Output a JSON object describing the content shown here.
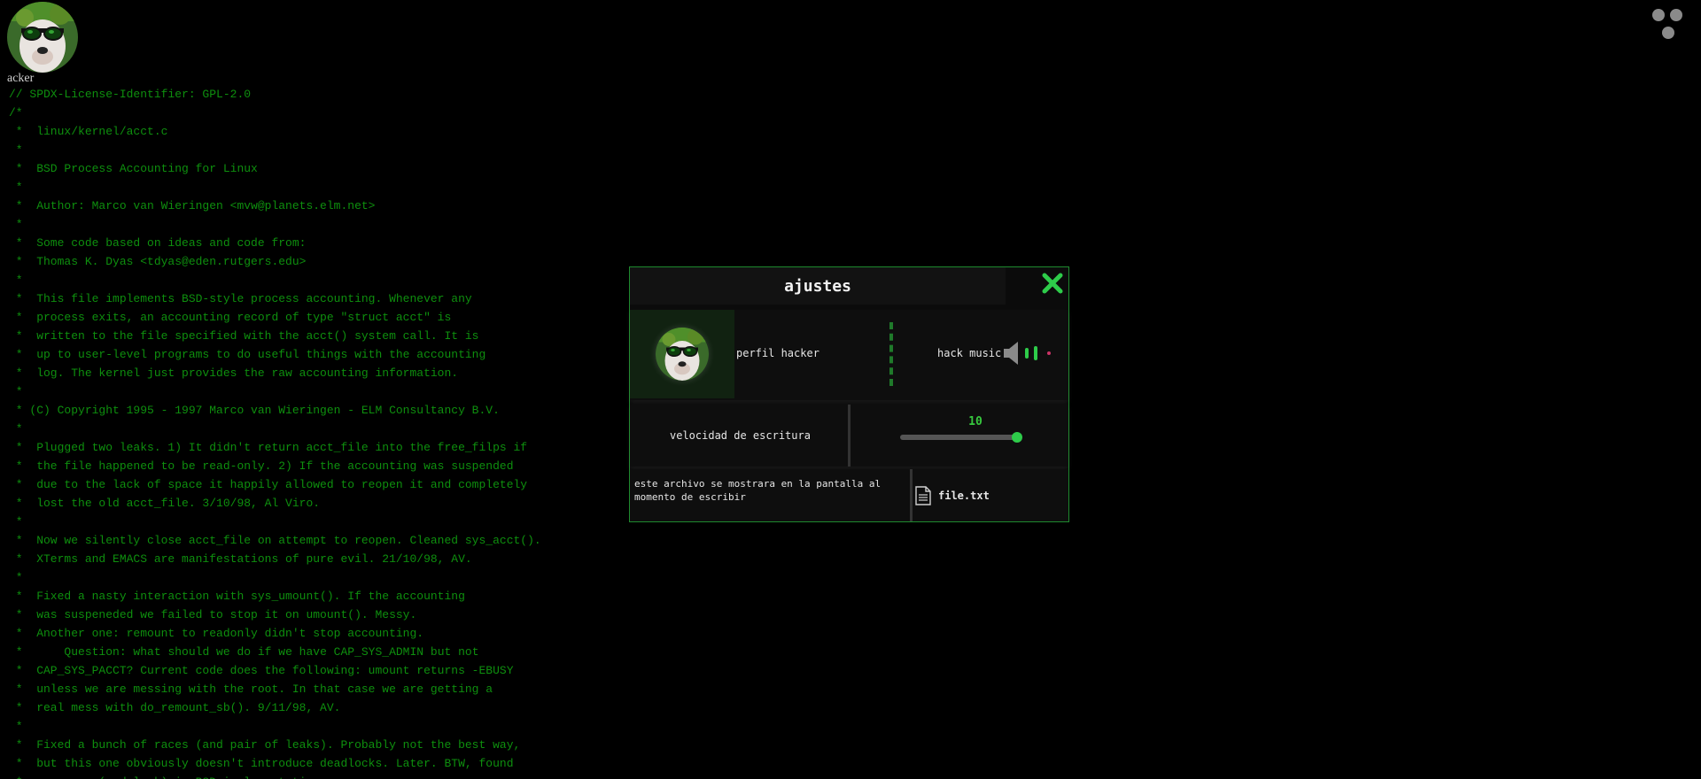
{
  "profile": {
    "name": "acker",
    "avatar_icon": "dog-with-sunglasses-avatar"
  },
  "menu": {
    "icon": "three-dots-menu-icon"
  },
  "code_lines": [
    "// SPDX-License-Identifier: GPL-2.0",
    "/*",
    " *  linux/kernel/acct.c",
    " *",
    " *  BSD Process Accounting for Linux",
    " *",
    " *  Author: Marco van Wieringen <mvw@planets.elm.net>",
    " *",
    " *  Some code based on ideas and code from:",
    " *  Thomas K. Dyas <tdyas@eden.rutgers.edu>",
    " *",
    " *  This file implements BSD-style process accounting. Whenever any",
    " *  process exits, an accounting record of type \"struct acct\" is",
    " *  written to the file specified with the acct() system call. It is",
    " *  up to user-level programs to do useful things with the accounting",
    " *  log. The kernel just provides the raw accounting information.",
    " *",
    " * (C) Copyright 1995 - 1997 Marco van Wieringen - ELM Consultancy B.V.",
    " *",
    " *  Plugged two leaks. 1) It didn't return acct_file into the free_filps if",
    " *  the file happened to be read-only. 2) If the accounting was suspended",
    " *  due to the lack of space it happily allowed to reopen it and completely",
    " *  lost the old acct_file. 3/10/98, Al Viro.",
    " *",
    " *  Now we silently close acct_file on attempt to reopen. Cleaned sys_acct().",
    " *  XTerms and EMACS are manifestations of pure evil. 21/10/98, AV.",
    " *",
    " *  Fixed a nasty interaction with sys_umount(). If the accounting",
    " *  was suspeneded we failed to stop it on umount(). Messy.",
    " *  Another one: remount to readonly didn't stop accounting.",
    " *\tQuestion: what should we do if we have CAP_SYS_ADMIN but not",
    " *  CAP_SYS_PACCT? Current code does the following: umount returns -EBUSY",
    " *  unless we are messing with the root. In that case we are getting a",
    " *  real mess with do_remount_sb(). 9/11/98, AV.",
    " *",
    " *  Fixed a bunch of races (and pair of leaks). Probably not the best way,",
    " *  but this one obviously doesn't introduce deadlocks. Later. BTW, found",
    " *  one race (and leak) in BSD implementation."
  ],
  "settings": {
    "title": "ajustes",
    "close_icon": "close-x-icon",
    "profile_label": "perfil hacker",
    "music_label": "hack music",
    "speaker_icon": "speaker-volume-icon",
    "speed_label": "velocidad de escritura",
    "speed_value": "10",
    "speed_fraction": 1.0,
    "file_description": "este archivo se mostrara en la pantalla al momento de escribir",
    "file_icon": "document-file-icon",
    "file_name": "file.txt",
    "accent_color": "#2ecc4a"
  }
}
